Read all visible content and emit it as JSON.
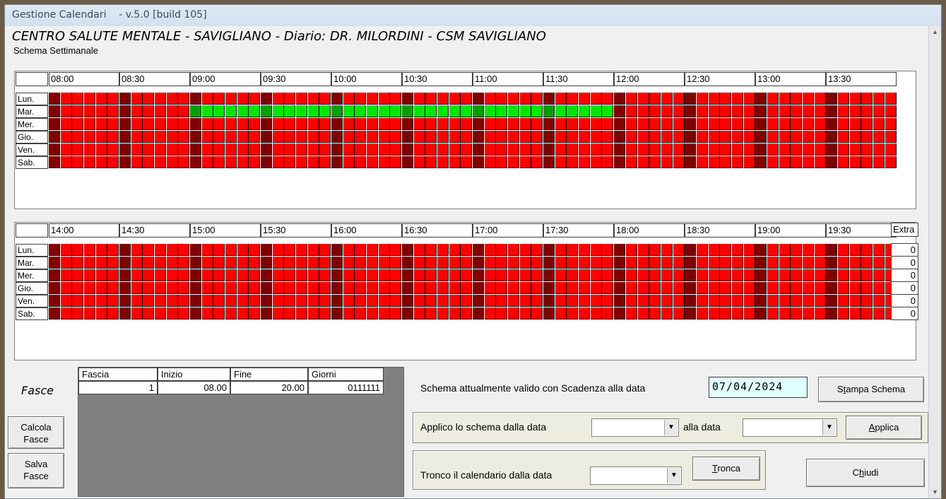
{
  "window": {
    "title": "Gestione Calendari    - v.5.0 [build 105]",
    "heading": "CENTRO SALUTE MENTALE - SAVIGLIANO - Diario: DR. MILORDINI - CSM SAVIGLIANO",
    "subheading": "Schema Settimanale"
  },
  "colors": {
    "unavailable": "#ff0000",
    "unavailable_hour_mark": "#800000",
    "available": "#00e600",
    "available_hour_mark": "#00a000"
  },
  "days": [
    "Lun.",
    "Mar.",
    "Mer.",
    "Gio.",
    "Ven.",
    "Sab."
  ],
  "morning": {
    "times": [
      "08:00",
      "08:30",
      "09:00",
      "09:30",
      "10:00",
      "10:30",
      "11:00",
      "11:30",
      "12:00",
      "12:30",
      "13:00",
      "13:30"
    ],
    "available": {
      "day_index": 1,
      "from_time": "09:00",
      "to_time": "12:00"
    }
  },
  "afternoon": {
    "times": [
      "14:00",
      "14:30",
      "15:00",
      "15:30",
      "16:00",
      "16:30",
      "17:00",
      "17:30",
      "18:00",
      "18:30",
      "19:00",
      "19:30"
    ],
    "extra_header": "Extra",
    "extra_values": [
      "0",
      "0",
      "0",
      "0",
      "0",
      "0"
    ]
  },
  "fasce": {
    "label": "Fasce",
    "columns": [
      "Fascia",
      "Inizio",
      "Fine",
      "Giorni"
    ],
    "rows": [
      [
        "1",
        "08.00",
        "20.00",
        "0111111"
      ]
    ]
  },
  "buttons": {
    "calcola_line1": "Calcola",
    "calcola_line2": "Fasce",
    "salva_line1": "Salva",
    "salva_line2": "Fasce",
    "stampa_pre": "S",
    "stampa_ul": "t",
    "stampa_post": "ampa Schema",
    "applica_ul": "A",
    "applica_post": "pplica",
    "tronca_ul": "T",
    "tronca_post": "ronca",
    "chiudi_pre": "C",
    "chiudi_ul": "h",
    "chiudi_post": "iudi"
  },
  "schema": {
    "label": "Schema attualmente valido con Scadenza alla data",
    "expiry_date": "07/04/2024"
  },
  "apply": {
    "from_label": "Applico lo schema dalla data",
    "from_value": "",
    "to_label": "alla data",
    "to_value": ""
  },
  "truncate": {
    "label": "Tronco il calendario dalla data",
    "value": ""
  }
}
